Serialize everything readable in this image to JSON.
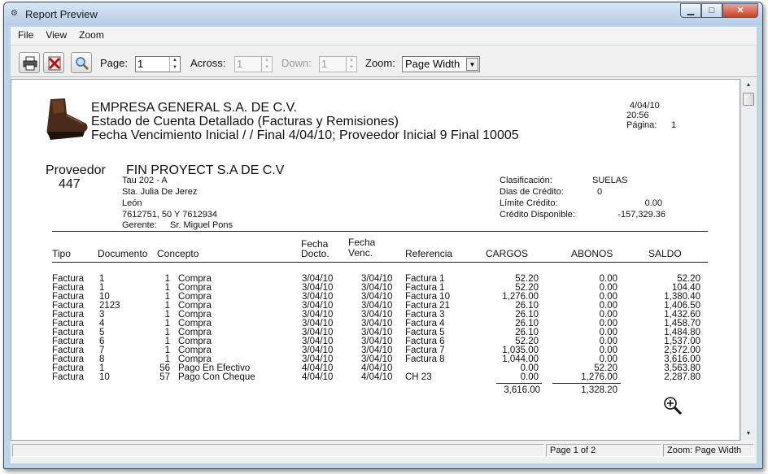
{
  "window": {
    "title": "Report Preview",
    "controls": {
      "minimize": "▁",
      "maximize": "□",
      "close": "✕"
    }
  },
  "menu": [
    "File",
    "View",
    "Zoom"
  ],
  "toolbar": {
    "page_label": "Page:",
    "page_value": "1",
    "across_label": "Across:",
    "across_value": "1",
    "down_label": "Down:",
    "down_value": "1",
    "zoom_label": "Zoom:",
    "zoom_value": "Page Width"
  },
  "report": {
    "company": "EMPRESA GENERAL S.A. DE C.V.",
    "title": "Estado de Cuenta Detallado (Facturas y Remisiones)",
    "subtitle": "Fecha Vencimiento Inicial   /  / Final  4/04/10;   Proveedor Inicial 9 Final 10005",
    "date": "4/04/10",
    "time": "20:56",
    "page_label": "Página:",
    "page_no": "1",
    "provider_label": "Proveedor",
    "provider_name": "FIN PROYECT S.A DE C.V",
    "provider_id": "447",
    "address": [
      "Tau 202 - A",
      "Sta. Julia De Jerez",
      "León",
      "7612751, 50 Y 7612934"
    ],
    "manager_label": "Gerente:",
    "manager": "Sr. Miguel Pons",
    "info_labels": [
      "Clasificación:",
      "Dias de Crédito:",
      "Límite Crédito:",
      "Crédito Disponible:"
    ],
    "info_values": [
      "SUELAS",
      "0",
      "0.00",
      "-157,329.36"
    ],
    "headers": {
      "tipo": "Tipo",
      "documento": "Documento",
      "concepto": "Concepto",
      "fecha_docto_1": "Fecha",
      "fecha_docto_2": "Docto.",
      "fecha_venc_1": "Fecha",
      "fecha_venc_2": "Venc.",
      "referencia": "Referencia",
      "cargos": "CARGOS",
      "abonos": "ABONOS",
      "saldo": "SALDO"
    },
    "rows": [
      {
        "tipo": "Factura",
        "doc": "1",
        "n": "1",
        "concepto": "Compra",
        "fdoc": "3/04/10",
        "fven": "3/04/10",
        "ref": "Factura 1",
        "cargos": "52.20",
        "abonos": "0.00",
        "saldo": "52.20"
      },
      {
        "tipo": "Factura",
        "doc": "1",
        "n": "1",
        "concepto": "Compra",
        "fdoc": "3/04/10",
        "fven": "3/04/10",
        "ref": "Factura 1",
        "cargos": "52.20",
        "abonos": "0.00",
        "saldo": "104.40"
      },
      {
        "tipo": "Factura",
        "doc": "10",
        "n": "1",
        "concepto": "Compra",
        "fdoc": "3/04/10",
        "fven": "3/04/10",
        "ref": "Factura 10",
        "cargos": "1,276.00",
        "abonos": "0.00",
        "saldo": "1,380.40"
      },
      {
        "tipo": "Factura",
        "doc": "2123",
        "n": "1",
        "concepto": "Compra",
        "fdoc": "3/04/10",
        "fven": "3/04/10",
        "ref": "Factura 21",
        "cargos": "26.10",
        "abonos": "0.00",
        "saldo": "1,406.50"
      },
      {
        "tipo": "Factura",
        "doc": "3",
        "n": "1",
        "concepto": "Compra",
        "fdoc": "3/04/10",
        "fven": "3/04/10",
        "ref": "Factura 3",
        "cargos": "26.10",
        "abonos": "0.00",
        "saldo": "1,432.60"
      },
      {
        "tipo": "Factura",
        "doc": "4",
        "n": "1",
        "concepto": "Compra",
        "fdoc": "3/04/10",
        "fven": "3/04/10",
        "ref": "Factura 4",
        "cargos": "26.10",
        "abonos": "0.00",
        "saldo": "1,458.70"
      },
      {
        "tipo": "Factura",
        "doc": "5",
        "n": "1",
        "concepto": "Compra",
        "fdoc": "3/04/10",
        "fven": "3/04/10",
        "ref": "Factura 5",
        "cargos": "26.10",
        "abonos": "0.00",
        "saldo": "1,484.80"
      },
      {
        "tipo": "Factura",
        "doc": "6",
        "n": "1",
        "concepto": "Compra",
        "fdoc": "3/04/10",
        "fven": "3/04/10",
        "ref": "Factura 6",
        "cargos": "52.20",
        "abonos": "0.00",
        "saldo": "1,537.00"
      },
      {
        "tipo": "Factura",
        "doc": "7",
        "n": "1",
        "concepto": "Compra",
        "fdoc": "3/04/10",
        "fven": "3/04/10",
        "ref": "Factura 7",
        "cargos": "1,035.00",
        "abonos": "0.00",
        "saldo": "2,572.00"
      },
      {
        "tipo": "Factura",
        "doc": "8",
        "n": "1",
        "concepto": "Compra",
        "fdoc": "3/04/10",
        "fven": "3/04/10",
        "ref": "Factura 8",
        "cargos": "1,044.00",
        "abonos": "0.00",
        "saldo": "3,616.00"
      },
      {
        "tipo": "Factura",
        "doc": "1",
        "n": "56",
        "concepto": "Pago En Efectivo",
        "fdoc": "4/04/10",
        "fven": "4/04/10",
        "ref": "",
        "cargos": "0.00",
        "abonos": "52.20",
        "saldo": "3,563.80"
      },
      {
        "tipo": "Factura",
        "doc": "10",
        "n": "57",
        "concepto": "Pago Con Cheque",
        "fdoc": "4/04/10",
        "fven": "4/04/10",
        "ref": "CH 23",
        "cargos": "0.00",
        "abonos": "1,276.00",
        "saldo": "2,287.80"
      }
    ],
    "total_cargos": "3,616.00",
    "total_abonos": "1,328.20"
  },
  "status": {
    "page": "Page 1 of 2",
    "zoom": "Zoom: Page Width"
  }
}
